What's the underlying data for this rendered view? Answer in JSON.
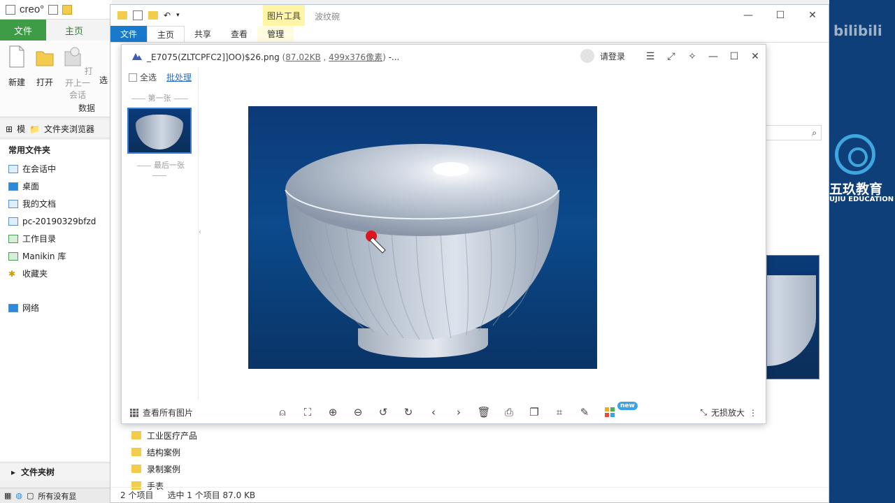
{
  "creo": {
    "logo": "creo°",
    "tabs": {
      "file": "文件",
      "home": "主页"
    },
    "ribbon": {
      "new": "新建",
      "open": "打开",
      "open_prev": "打开上一",
      "open_prev_2": "会话",
      "select": "选",
      "group_label": "数据"
    },
    "side_tabs": {
      "model_tree": "模",
      "folder_browser": "文件夹浏览器"
    },
    "tree": {
      "heading": "常用文件夹",
      "items": [
        {
          "label": "在会话中",
          "icon": "monitor-icon"
        },
        {
          "label": "桌面",
          "icon": "desktop-icon"
        },
        {
          "label": "我的文档",
          "icon": "documents-icon"
        },
        {
          "label": "pc-20190329bfzd",
          "icon": "computer-icon"
        },
        {
          "label": "工作目录",
          "icon": "folder-icon"
        },
        {
          "label": "Manikin 库",
          "icon": "library-icon"
        },
        {
          "label": "收藏夹",
          "icon": "star-icon"
        }
      ],
      "network": "网络"
    },
    "footer": "文件夹树",
    "status": "所有没有显"
  },
  "explorer": {
    "context_tab": "图片工具",
    "title": "波纹碗",
    "tabs": [
      "文件",
      "主页",
      "共享",
      "查看",
      "管理"
    ],
    "nav_folders": [
      "工业医疗产品",
      "结构案例",
      "录制案例",
      "手表"
    ],
    "status": {
      "count": "2 个项目",
      "selected": "选中 1 个项目 87.0 KB"
    }
  },
  "brand": {
    "cn": "五玖教育",
    "en": "UJIU EDUCATION",
    "watermark": "bilibili"
  },
  "viewer": {
    "filename": "_E7075(ZLTCPFC2]]OO)$26.png",
    "size": "87.02KB",
    "dims": "499x376像素",
    "suffix": "-...",
    "login": "请登录",
    "select_all": "全选",
    "batch": "批处理",
    "first_label": "第一张",
    "last_label": "最后一张",
    "view_all": "查看所有图片",
    "new_badge": "new",
    "lossless": "无损放大",
    "colors": {
      "accent": "#1979ca",
      "link": "#2a6fce",
      "image_bg": "#0b4a8c"
    }
  }
}
